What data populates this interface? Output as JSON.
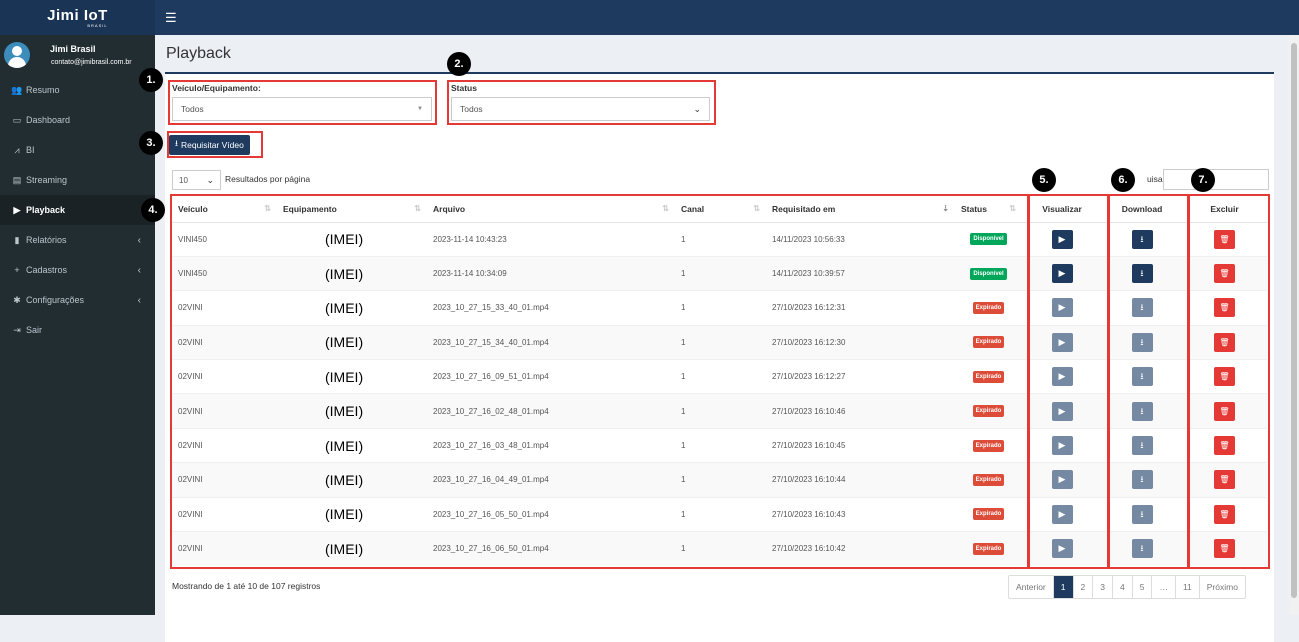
{
  "app": {
    "logo_main": "Jimi IoT",
    "logo_sub": "BRASIL"
  },
  "user": {
    "name": "Jimi Brasil",
    "email": "contato@jimibrasil.com.br"
  },
  "nav": [
    {
      "label": "Resumo",
      "icon": "users-icon",
      "glyph": "👥"
    },
    {
      "label": "Dashboard",
      "icon": "monitor-icon",
      "glyph": "▭"
    },
    {
      "label": "BI",
      "icon": "chart-line-icon",
      "glyph": "⩘"
    },
    {
      "label": "Streaming",
      "icon": "film-icon",
      "glyph": "▤"
    },
    {
      "label": "Playback",
      "icon": "play-circle-icon",
      "glyph": "▶"
    },
    {
      "label": "Relatórios",
      "icon": "file-icon",
      "glyph": "▮"
    },
    {
      "label": "Cadastros",
      "icon": "plus-icon",
      "glyph": "+"
    },
    {
      "label": "Configurações",
      "icon": "gear-icon",
      "glyph": "✱"
    },
    {
      "label": "Sair",
      "icon": "sign-out-icon",
      "glyph": "⇥"
    }
  ],
  "page": {
    "title": "Playback"
  },
  "filters": {
    "vehicle_label": "Veículo/Equipamento:",
    "vehicle_value": "Todos",
    "status_label": "Status",
    "status_value": "Todos",
    "request_button": "Requisitar Vídeo"
  },
  "table_controls": {
    "page_length": "10",
    "page_length_label": "Resultados por página",
    "search_label": "uisar"
  },
  "annotations": [
    "1.",
    "2.",
    "3.",
    "4.",
    "5.",
    "6.",
    "7."
  ],
  "columns": [
    "Veículo",
    "Equipamento",
    "Arquivo",
    "Canal",
    "Requisitado em",
    "Status",
    "Visualizar",
    "Download",
    "Excluir"
  ],
  "rows": [
    {
      "vehicle": "VINI450",
      "device": "(IMEI)",
      "file": "2023-11-14 10:43:23",
      "channel": "1",
      "requested": "14/11/2023 10:56:33",
      "status": "Disponível",
      "available": true
    },
    {
      "vehicle": "VINI450",
      "device": "(IMEI)",
      "file": "2023-11-14 10:34:09",
      "channel": "1",
      "requested": "14/11/2023 10:39:57",
      "status": "Disponível",
      "available": true
    },
    {
      "vehicle": "02VINI",
      "device": "(IMEI)",
      "file": "2023_10_27_15_33_40_01.mp4",
      "channel": "1",
      "requested": "27/10/2023 16:12:31",
      "status": "Expirado",
      "available": false
    },
    {
      "vehicle": "02VINI",
      "device": "(IMEI)",
      "file": "2023_10_27_15_34_40_01.mp4",
      "channel": "1",
      "requested": "27/10/2023 16:12:30",
      "status": "Expirado",
      "available": false
    },
    {
      "vehicle": "02VINI",
      "device": "(IMEI)",
      "file": "2023_10_27_16_09_51_01.mp4",
      "channel": "1",
      "requested": "27/10/2023 16:12:27",
      "status": "Expirado",
      "available": false
    },
    {
      "vehicle": "02VINI",
      "device": "(IMEI)",
      "file": "2023_10_27_16_02_48_01.mp4",
      "channel": "1",
      "requested": "27/10/2023 16:10:46",
      "status": "Expirado",
      "available": false
    },
    {
      "vehicle": "02VINI",
      "device": "(IMEI)",
      "file": "2023_10_27_16_03_48_01.mp4",
      "channel": "1",
      "requested": "27/10/2023 16:10:45",
      "status": "Expirado",
      "available": false
    },
    {
      "vehicle": "02VINI",
      "device": "(IMEI)",
      "file": "2023_10_27_16_04_49_01.mp4",
      "channel": "1",
      "requested": "27/10/2023 16:10:44",
      "status": "Expirado",
      "available": false
    },
    {
      "vehicle": "02VINI",
      "device": "(IMEI)",
      "file": "2023_10_27_16_05_50_01.mp4",
      "channel": "1",
      "requested": "27/10/2023 16:10:43",
      "status": "Expirado",
      "available": false
    },
    {
      "vehicle": "02VINI",
      "device": "(IMEI)",
      "file": "2023_10_27_16_06_50_01.mp4",
      "channel": "1",
      "requested": "27/10/2023 16:10:42",
      "status": "Expirado",
      "available": false
    }
  ],
  "footer": {
    "info": "Mostrando de 1 até 10 de 107 registros",
    "pagination": [
      "Anterior",
      "1",
      "2",
      "3",
      "4",
      "5",
      "…",
      "11",
      "Próximo"
    ],
    "current_page": "1"
  },
  "colors": {
    "primary": "#1e3a5f",
    "sidebar": "#222d32",
    "success": "#00a65a",
    "danger": "#dd4b39",
    "delete": "#e53935",
    "annotation_border": "#e53935"
  }
}
